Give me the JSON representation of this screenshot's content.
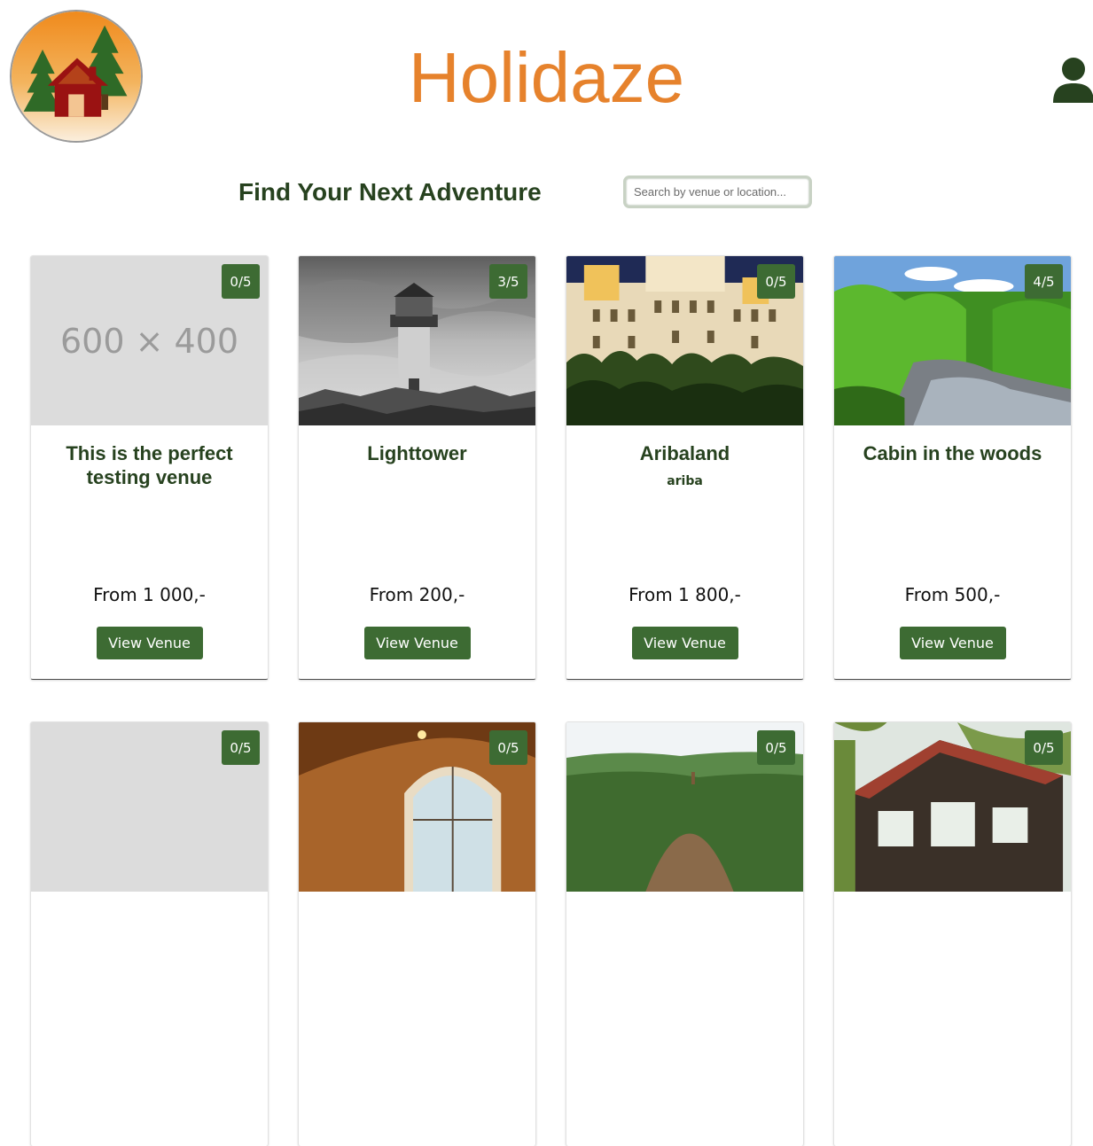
{
  "header": {
    "site_title": "Holidaze",
    "logo_icon": "cabin-trees-logo",
    "user_icon": "user-icon"
  },
  "hero": {
    "tagline": "Find Your Next Adventure",
    "search_placeholder": "Search by venue or location..."
  },
  "colors": {
    "brand_orange": "#e6822c",
    "dark_green": "#27421f",
    "button_green": "#3d6b33"
  },
  "venues": [
    {
      "title": "This is the perfect testing venue",
      "subtitle": "",
      "price": "From 1 000,-",
      "rating": "0/5",
      "image": "600 × 400",
      "button": "View Venue"
    },
    {
      "title": "Lighttower",
      "subtitle": "",
      "price": "From 200,-",
      "rating": "3/5",
      "image": "lighthouse-photo",
      "button": "View Venue"
    },
    {
      "title": "Aribaland",
      "subtitle": "ariba",
      "price": "From 1 800,-",
      "rating": "0/5",
      "image": "palace-hotel-photo",
      "button": "View Venue"
    },
    {
      "title": "Cabin in the woods",
      "subtitle": "",
      "price": "From 500,-",
      "rating": "4/5",
      "image": "forest-river-photo",
      "button": "View Venue"
    },
    {
      "title": "",
      "subtitle": "",
      "price": "",
      "rating": "0/5",
      "image": "placeholder",
      "button": ""
    },
    {
      "title": "",
      "subtitle": "",
      "price": "",
      "rating": "0/5",
      "image": "arched-interior-photo",
      "button": ""
    },
    {
      "title": "",
      "subtitle": "",
      "price": "",
      "rating": "0/5",
      "image": "hilltop-photo",
      "button": ""
    },
    {
      "title": "",
      "subtitle": "",
      "price": "",
      "rating": "0/5",
      "image": "lodge-photo",
      "button": ""
    }
  ]
}
